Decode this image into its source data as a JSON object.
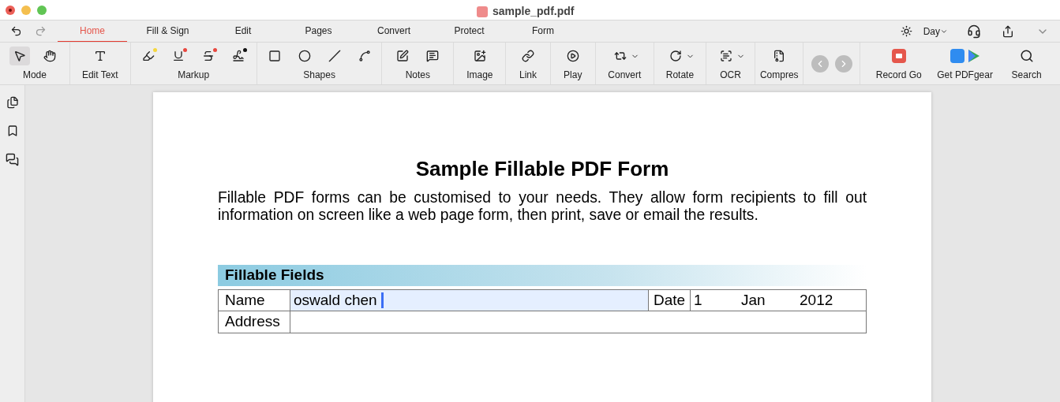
{
  "window": {
    "title": "sample_pdf.pdf"
  },
  "tabs": [
    {
      "label": "Home",
      "selected": true
    },
    {
      "label": "Fill & Sign",
      "selected": false
    },
    {
      "label": "Edit",
      "selected": false
    },
    {
      "label": "Pages",
      "selected": false
    },
    {
      "label": "Convert",
      "selected": false
    },
    {
      "label": "Protect",
      "selected": false
    },
    {
      "label": "Form",
      "selected": false
    }
  ],
  "appearance": {
    "label": "Day"
  },
  "toolbar": [
    {
      "label": "Mode",
      "tools": [
        {
          "selected": true
        },
        {
          "selected": false
        }
      ]
    },
    {
      "label": "Edit Text"
    },
    {
      "label": "Markup",
      "tools": [
        {
          "color": "#f5d63d"
        },
        {
          "color": "#e8473f"
        },
        {
          "color": "#e8473f"
        },
        {
          "color": "#111111"
        }
      ]
    },
    {
      "label": "Shapes"
    },
    {
      "label": "Notes"
    },
    {
      "label": "Image"
    },
    {
      "label": "Link"
    },
    {
      "label": "Play"
    },
    {
      "label": "Convert",
      "dropdown": true
    },
    {
      "label": "Rotate",
      "dropdown": true
    },
    {
      "label": "OCR",
      "dropdown": true
    },
    {
      "label": "Compres"
    }
  ],
  "actions": [
    {
      "label": "Record Go"
    },
    {
      "label": "Get PDFgear"
    },
    {
      "label": "Search"
    }
  ],
  "document": {
    "title": "Sample Fillable PDF Form",
    "intro": "Fillable PDF forms can be customised to your needs. They allow form recipients to fill out information on screen like a web page form, then print, save or email the results.",
    "section": "Fillable Fields",
    "fields": [
      {
        "label": "Name",
        "value": "oswald chen",
        "focused": true
      },
      {
        "label": "Date",
        "day": "1",
        "month": "Jan",
        "year": "2012"
      },
      {
        "label": "Address"
      }
    ]
  }
}
